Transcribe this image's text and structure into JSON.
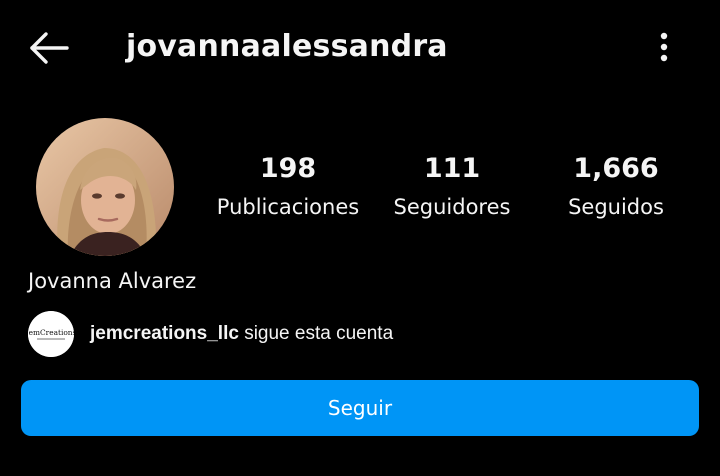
{
  "header": {
    "back_icon": "arrow-left-icon",
    "username": "jovannaalessandra",
    "more_icon": "more-vertical-icon"
  },
  "profile": {
    "full_name": "Jovanna Alvarez",
    "stats": {
      "posts": {
        "value": "198",
        "label": "Publicaciones"
      },
      "followers": {
        "value": "111",
        "label": "Seguidores"
      },
      "following": {
        "value": "1,666",
        "label": "Seguidos"
      }
    }
  },
  "mutual": {
    "avatar_text": "JemCreations",
    "username": "jemcreations_llc",
    "text": " sigue esta cuenta"
  },
  "actions": {
    "follow_label": "Seguir"
  },
  "colors": {
    "background": "#000000",
    "text": "#f5f5f5",
    "follow_button": "#0095f6"
  }
}
